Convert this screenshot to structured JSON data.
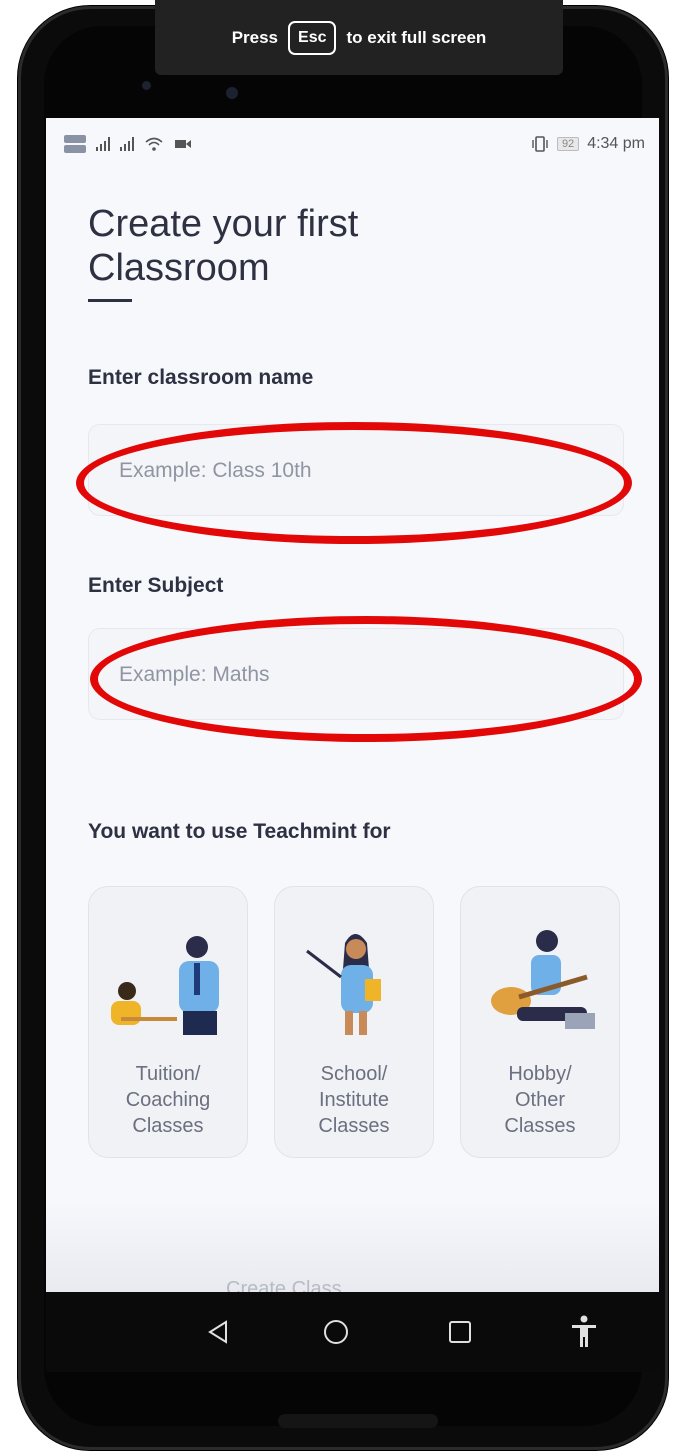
{
  "fullscreen_notice": {
    "prefix": "Press",
    "key": "Esc",
    "suffix": "to exit full screen"
  },
  "status_bar": {
    "battery": "92",
    "time": "4:34 pm"
  },
  "page": {
    "title_line1": "Create your first",
    "title_line2": "Classroom"
  },
  "form": {
    "classroom_label": "Enter classroom name",
    "classroom_placeholder": "Example: Class 10th",
    "subject_label": "Enter Subject",
    "subject_placeholder": "Example: Maths"
  },
  "usage": {
    "heading": "You want to use Teachmint for",
    "options": [
      {
        "lines": [
          "Tuition/",
          "Coaching",
          "Classes"
        ],
        "icon": "tutor-student-illustration"
      },
      {
        "lines": [
          "School/",
          "Institute",
          "Classes"
        ],
        "icon": "teacher-pointer-illustration"
      },
      {
        "lines": [
          "Hobby/",
          "Other",
          "Classes"
        ],
        "icon": "guitar-laptop-illustration"
      }
    ]
  },
  "partially_visible_text": "Create Class",
  "nav_bar": {
    "icons": [
      "back-icon",
      "home-icon",
      "recents-icon",
      "accessibility-icon"
    ]
  },
  "colors": {
    "annotation": "#e30808",
    "title": "#2d3142",
    "placeholder": "#8f95a3"
  }
}
